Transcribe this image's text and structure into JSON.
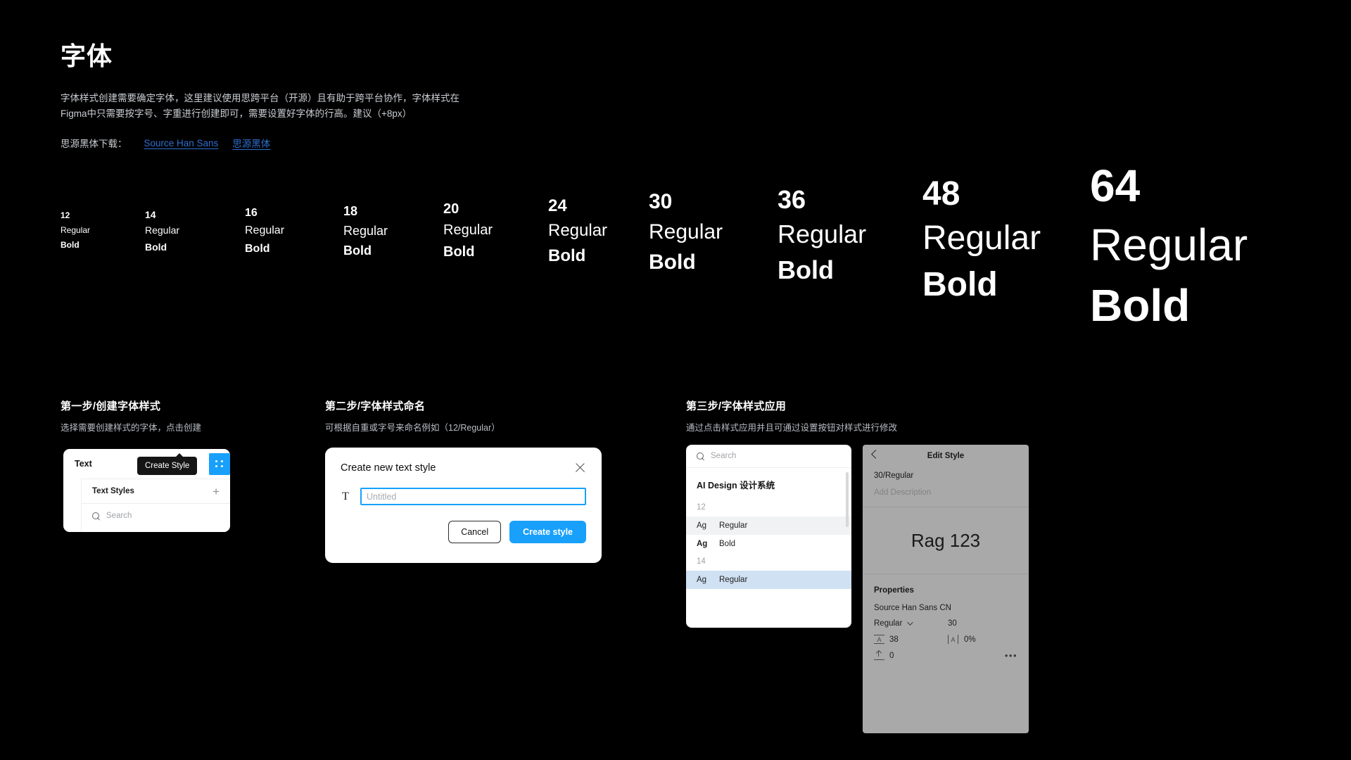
{
  "header": {
    "title": "字体",
    "description": "字体样式创建需要确定字体，这里建议使用思跨平台（开源）且有助于跨平台协作，字体样式在\nFigma中只需要按字号、字重进行创建即可，需要设置好字体的行高。建议（+8px）",
    "download_label": "思源黑体下载：",
    "links": [
      {
        "label": "Source Han Sans"
      },
      {
        "label": "思源黑体"
      }
    ],
    "link_color": "#2f6fd0"
  },
  "specimens": [
    {
      "size": "12",
      "regular": "Regular",
      "bold": "Bold"
    },
    {
      "size": "14",
      "regular": "Regular",
      "bold": "Bold"
    },
    {
      "size": "16",
      "regular": "Regular",
      "bold": "Bold"
    },
    {
      "size": "18",
      "regular": "Regular",
      "bold": "Bold"
    },
    {
      "size": "20",
      "regular": "Regular",
      "bold": "Bold"
    },
    {
      "size": "24",
      "regular": "Regular",
      "bold": "Bold"
    },
    {
      "size": "30",
      "regular": "Regular",
      "bold": "Bold"
    },
    {
      "size": "36",
      "regular": "Regular",
      "bold": "Bold"
    },
    {
      "size": "48",
      "regular": "Regular",
      "bold": "Bold"
    },
    {
      "size": "64",
      "regular": "Regular",
      "bold": "Bold"
    }
  ],
  "steps": [
    {
      "title": "第一步/创建字体样式",
      "subtitle": "选择需要创建样式的字体，点击创建"
    },
    {
      "title": "第二步/字体样式命名",
      "subtitle": "可根据自重或字号来命名例如（12/Regular）"
    },
    {
      "title": "第三步/字体样式应用",
      "subtitle": "通过点击样式应用并且可通过设置按钮对样式进行修改"
    }
  ],
  "step1": {
    "text_label": "Text",
    "styles_header": "Text Styles",
    "add_icon": "+",
    "search_placeholder": "Search",
    "tooltip": "Create Style",
    "accent_color": "#18A0FB"
  },
  "step2": {
    "dialog_title": "Create new text style",
    "close_icon": "close-icon",
    "type_icon": "T",
    "input_value": "",
    "input_placeholder": "Untitled",
    "cancel_label": "Cancel",
    "create_label": "Create style",
    "accent_color": "#18A0FB"
  },
  "step3": {
    "search_placeholder": "Search",
    "group_name": "AI Design 设计系统",
    "groups": [
      {
        "size": "12",
        "items": [
          {
            "ag": "Ag",
            "name": "Regular",
            "weight": "regular",
            "state": "hover"
          },
          {
            "ag": "Ag",
            "name": "Bold",
            "weight": "bold",
            "state": "normal"
          }
        ]
      },
      {
        "size": "14",
        "items": [
          {
            "ag": "Ag",
            "name": "Regular",
            "weight": "regular",
            "state": "selected"
          }
        ]
      }
    ],
    "selection_color": "#cfe1f3"
  },
  "edit_style": {
    "back_icon": "chevron-left-icon",
    "title": "Edit Style",
    "style_name": "30/Regular",
    "description_placeholder": "Add Description",
    "preview_text": "Rag 123",
    "properties_title": "Properties",
    "font_family": "Source Han Sans CN",
    "font_weight": "Regular",
    "font_size": "30",
    "line_height": "38",
    "letter_spacing": "0%",
    "paragraph_spacing": "0",
    "more_icon": "•••"
  }
}
